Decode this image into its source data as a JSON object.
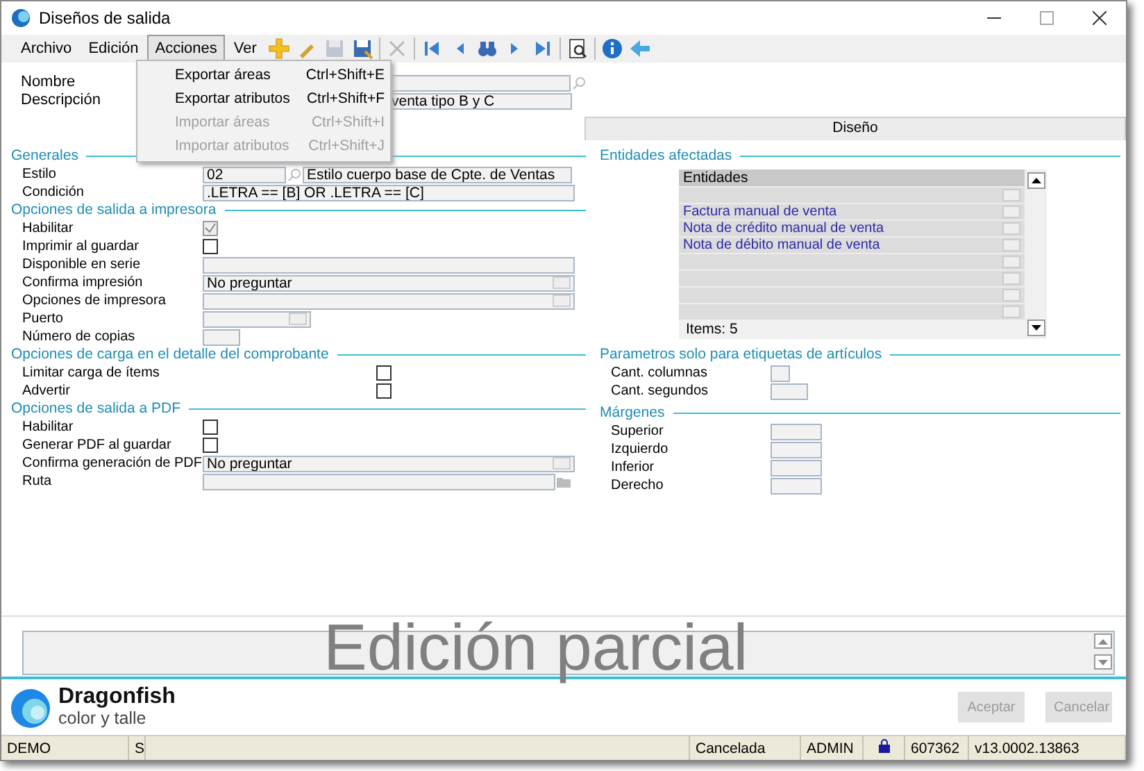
{
  "window": {
    "title": "Diseños de salida"
  },
  "menus": [
    {
      "label": "Archivo",
      "open": false
    },
    {
      "label": "Edición",
      "open": false
    },
    {
      "label": "Acciones",
      "open": true
    },
    {
      "label": "Ver",
      "open": false
    }
  ],
  "toolbar": [
    {
      "kind": "new",
      "disabled": false
    },
    {
      "kind": "edit",
      "disabled": false
    },
    {
      "kind": "save",
      "disabled": true
    },
    {
      "kind": "saveas",
      "disabled": false
    },
    {
      "kind": "sep"
    },
    {
      "kind": "delete",
      "disabled": true
    },
    {
      "kind": "sep"
    },
    {
      "kind": "first",
      "disabled": false
    },
    {
      "kind": "prev",
      "disabled": false
    },
    {
      "kind": "find",
      "disabled": false
    },
    {
      "kind": "next",
      "disabled": false
    },
    {
      "kind": "last",
      "disabled": false
    },
    {
      "kind": "sep"
    },
    {
      "kind": "preview",
      "disabled": false
    },
    {
      "kind": "sep"
    },
    {
      "kind": "info",
      "disabled": false
    },
    {
      "kind": "back",
      "disabled": false
    }
  ],
  "dropdown": [
    {
      "label": "Exportar áreas",
      "shortcut": "Ctrl+Shift+E",
      "disabled": false
    },
    {
      "label": "Exportar atributos",
      "shortcut": "Ctrl+Shift+F",
      "disabled": false
    },
    {
      "label": "Importar áreas",
      "shortcut": "Ctrl+Shift+I",
      "disabled": true
    },
    {
      "label": "Importar atributos",
      "shortcut": "Ctrl+Shift+J",
      "disabled": true
    }
  ],
  "header_fields": [
    {
      "label": "Nombre",
      "kind": "lookup"
    },
    {
      "label": "Descripción",
      "value": "venta tipo B y C"
    }
  ],
  "tabs": [
    {
      "label": "Diseño",
      "selected": false
    }
  ],
  "left_sections": [
    {
      "title": "Generales",
      "fields": [
        {
          "label": "Estilo",
          "kind": "lookup",
          "code": "02",
          "value": "Estilo cuerpo base de Cpte. de Ventas"
        },
        {
          "label": "Condición",
          "kind": "text",
          "value": ".LETRA == [B] OR .LETRA == [C]"
        }
      ]
    },
    {
      "title": "Opciones de salida a impresora",
      "fields": [
        {
          "label": "Habilitar",
          "kind": "check",
          "checked": true,
          "disabled": true
        },
        {
          "label": "Imprimir al guardar",
          "kind": "check",
          "checked": false,
          "disabled": false
        },
        {
          "label": "Disponible en serie",
          "kind": "text"
        },
        {
          "label": "Confirma impresión",
          "kind": "combo",
          "value": "No preguntar"
        },
        {
          "label": "Opciones de impresora",
          "kind": "combo"
        },
        {
          "label": "Puerto",
          "kind": "shortcombo"
        },
        {
          "label": "Número de copias",
          "kind": "number"
        }
      ]
    },
    {
      "title": "Opciones de carga en el detalle del comprobante",
      "fields": [
        {
          "label": "Limitar carga de ítems",
          "kind": "check",
          "checked": false,
          "disabled": false
        },
        {
          "label": "Advertir",
          "kind": "check",
          "checked": false,
          "disabled": false
        }
      ]
    },
    {
      "title": "Opciones de salida a PDF",
      "fields": [
        {
          "label": "Habilitar",
          "kind": "check",
          "checked": false,
          "disabled": false
        },
        {
          "label": "Generar PDF al guardar",
          "kind": "check",
          "checked": false,
          "disabled": false
        },
        {
          "label": "Confirma generación de PDF",
          "kind": "combo",
          "value": "No preguntar"
        },
        {
          "label": "Ruta",
          "kind": "path"
        }
      ]
    }
  ],
  "entities": {
    "title": "Entidades afectadas",
    "header": "Entidades",
    "rows": [
      "",
      "Factura manual de venta",
      "Nota de crédito manual de venta",
      "Nota de débito manual de venta",
      "",
      "",
      "",
      ""
    ],
    "count": "Items: 5"
  },
  "right_sections": [
    {
      "title": "Parametros solo para etiquetas de artículos",
      "fields": [
        {
          "label": "Cant. columnas",
          "kind": "tiny"
        },
        {
          "label": "Cant. segundos",
          "kind": "number"
        }
      ]
    },
    {
      "title": "Márgenes",
      "fields": [
        {
          "label": "Superior",
          "kind": "margin"
        },
        {
          "label": "Izquierdo",
          "kind": "margin"
        },
        {
          "label": "Inferior",
          "kind": "margin"
        },
        {
          "label": "Derecho",
          "kind": "margin"
        }
      ]
    }
  ],
  "overlay_text": "Edición parcial",
  "logo": {
    "name": "Dragonfish",
    "tagline": "color y talle"
  },
  "buttons": [
    {
      "label": "Aceptar",
      "disabled": true
    },
    {
      "label": "Cancelar",
      "disabled": true
    }
  ],
  "status_bar": [
    {
      "kind": "text",
      "text": "DEMO"
    },
    {
      "kind": "text",
      "text": "S"
    },
    {
      "kind": "blank"
    },
    {
      "kind": "text",
      "text": "Cancelada"
    },
    {
      "kind": "text",
      "text": "ADMIN"
    },
    {
      "kind": "lock"
    },
    {
      "kind": "text",
      "text": "607362"
    },
    {
      "kind": "text",
      "text": "v13.0002.13863"
    }
  ]
}
